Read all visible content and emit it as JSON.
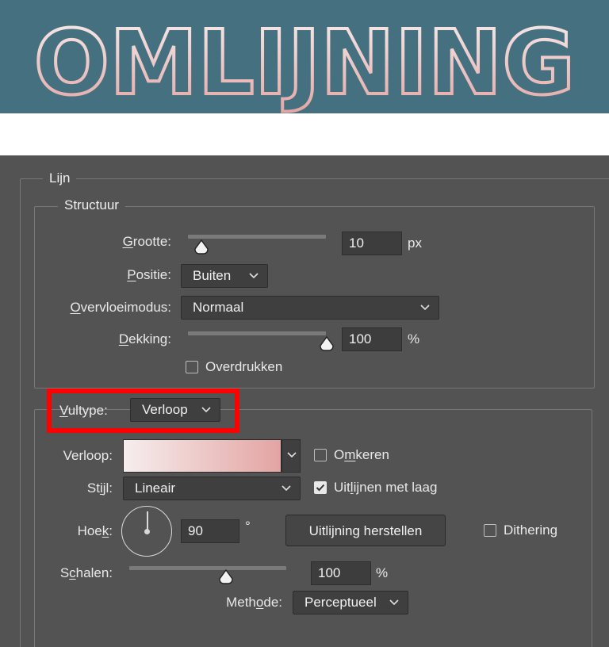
{
  "banner": {
    "text": "OMLIJNING"
  },
  "lijn": {
    "legend": "Lijn"
  },
  "structuur": {
    "legend": "Structuur",
    "grootte": {
      "label": "Grootte:",
      "mnemonic": "G",
      "rest": "rootte:",
      "value": "10",
      "unit": "px",
      "slider_fraction": 0.1
    },
    "positie": {
      "label": "Positie:",
      "mnemonic": "P",
      "rest": "ositie:",
      "value": "Buiten"
    },
    "overvloeimodus": {
      "label": "Overvloeimodus:",
      "mnemonic": "O",
      "rest": "vervloeimodus:",
      "value": "Normaal"
    },
    "dekking": {
      "label": "Dekking:",
      "mnemonic": "D",
      "rest": "ekking:",
      "value": "100",
      "unit": "%",
      "slider_fraction": 1.0
    },
    "overdrukken": {
      "label": "Overdrukken",
      "checked": false
    }
  },
  "vulling": {
    "vultype": {
      "label": "Vultype:",
      "mnemonic": "V",
      "rest": "ultype:",
      "value": "Verloop"
    },
    "verloop": {
      "label": "Verloop:",
      "gradient_start": "#f6eeee",
      "gradient_end": "#e3a4a2"
    },
    "omkeren": {
      "pre": "O",
      "mnemonic": "m",
      "rest": "keren",
      "checked": false
    },
    "stijl": {
      "pre": "St",
      "mnemonic": "i",
      "rest": "jl:",
      "value": "Lineair"
    },
    "uitlijnen": {
      "pre": "Uit",
      "mnemonic": "l",
      "rest": "ijnen met laag",
      "checked": true
    },
    "hoek": {
      "pre": "Hoe",
      "mnemonic": "k",
      "rest": ":",
      "value": "90",
      "unit": "°"
    },
    "reset_button": "Uitlijning herstellen",
    "dithering": {
      "label": "Dithering",
      "checked": false
    },
    "schalen": {
      "pre": "S",
      "mnemonic": "c",
      "rest": "halen:",
      "value": "100",
      "unit": "%",
      "slider_fraction": 0.6
    },
    "methode": {
      "pre": "Meth",
      "mnemonic": "o",
      "rest": "de:",
      "value": "Perceptueel"
    }
  },
  "colors": {
    "banner_bg": "#447080",
    "panel_bg": "#535353",
    "highlight": "#ff0000",
    "banner_text_start": "#f5f0f0",
    "banner_text_end": "#e4a9a7"
  }
}
